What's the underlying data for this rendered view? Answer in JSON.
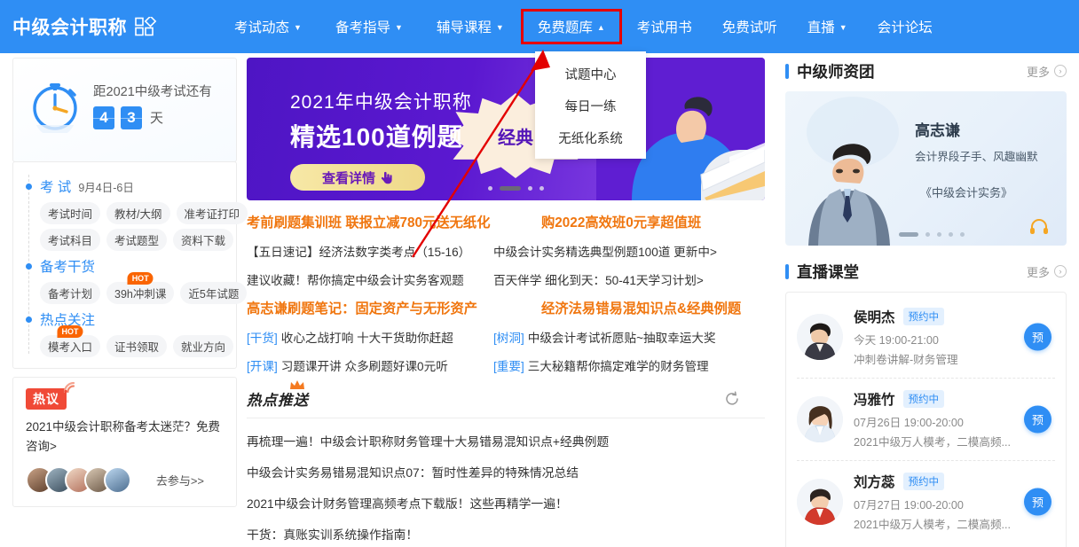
{
  "header": {
    "logo_text": "中级会计职称",
    "logo_icon": "grid-diamond-icon",
    "nav": [
      {
        "label": "考试动态",
        "caret": "▼"
      },
      {
        "label": "备考指导",
        "caret": "▼"
      },
      {
        "label": "辅导课程",
        "caret": "▼"
      },
      {
        "label": "免费题库",
        "caret": "▲",
        "active": true
      },
      {
        "label": "考试用书",
        "caret": ""
      },
      {
        "label": "免费试听",
        "caret": ""
      },
      {
        "label": "直播",
        "caret": "▼"
      },
      {
        "label": "会计论坛",
        "caret": ""
      }
    ],
    "highlight_color": "#e60000",
    "bar_color": "#2f8ef4"
  },
  "dropdown": {
    "items": [
      "试题中心",
      "每日一练",
      "无纸化系统"
    ]
  },
  "sidebar_left": {
    "countdown": {
      "label": "距2021中级考试还有",
      "digits": [
        "4",
        "3"
      ],
      "unit": "天",
      "icon": "stopwatch-icon"
    },
    "groups": [
      {
        "title": "考 试",
        "sub": "9月4日-6日",
        "rows": [
          [
            {
              "label": "考试时间"
            },
            {
              "label": "教材/大纲"
            },
            {
              "label": "准考证打印"
            }
          ],
          [
            {
              "label": "考试科目"
            },
            {
              "label": "考试题型"
            },
            {
              "label": "资料下载"
            }
          ]
        ]
      },
      {
        "title": "备考干货",
        "sub": "",
        "rows": [
          [
            {
              "label": "备考计划"
            },
            {
              "label": "39h冲刺课",
              "badge": "HOT"
            },
            {
              "label": "近5年试题"
            }
          ]
        ]
      },
      {
        "title": "热点关注",
        "sub": "",
        "rows": [
          [
            {
              "label": "模考入口",
              "badge": "HOT"
            },
            {
              "label": "证书领取"
            },
            {
              "label": "就业方向"
            }
          ]
        ]
      }
    ],
    "discussion": {
      "tag": "热议",
      "text": "2021中级会计职称备考太迷茫？免费咨询>",
      "go": "去参与>>",
      "avatar_count": 5
    }
  },
  "banner": {
    "line1": "2021年中级会计职称",
    "line2": "精选100道例题",
    "button": "查看详情",
    "button_icon": "hand-pointer-icon",
    "burst": "经典",
    "dot_count": 4,
    "active_dot": 1
  },
  "news": {
    "headline_row1": [
      "考前刷题集训班 联报立减780元送无纸化",
      "购2022高效班0元享超值班"
    ],
    "rows1": [
      [
        "【五日速记】经济法数字类考点（15-16）",
        "中级会计实务精选典型例题100道 更新中>"
      ],
      [
        "建议收藏！帮你搞定中级会计实务客观题",
        "百天伴学 细化到天：50-41天学习计划>"
      ]
    ],
    "headline_row2": [
      "高志谦刷题笔记：固定资产与无形资产",
      "经济法易错易混知识点&经典例题"
    ],
    "rows2": [
      [
        {
          "tag": "[干货]",
          "text": "收心之战打响 十大干货助你赶超"
        },
        {
          "tag": "[树洞]",
          "text": "中级会计考试祈愿贴~抽取幸运大奖"
        }
      ],
      [
        {
          "tag": "[开课]",
          "text": "习题课开讲 众多刷题好课0元听"
        },
        {
          "tag": "[重要]",
          "text": "三大秘籍帮你搞定难学的财务管理"
        }
      ]
    ]
  },
  "hot_push": {
    "title": "热点推送",
    "refresh_icon": "refresh-icon",
    "items": [
      "再梳理一遍！中级会计职称财务管理十大易错易混知识点+经典例题",
      "中级会计实务易错易混知识点07：暂时性差异的特殊情况总结",
      "2021中级会计财务管理高频考点下载版！这些再精学一遍！",
      "干货：真账实训系统操作指南！"
    ]
  },
  "sidebar_right": {
    "teachers_section": {
      "title": "中级师资团",
      "more": "更多",
      "teacher": {
        "name": "高志谦",
        "desc": "会计界段子手、风趣幽默",
        "book": "《中级会计实务》",
        "headset_icon": "headset-icon"
      },
      "dot_count": 5,
      "active_dot": 0
    },
    "live_section": {
      "title": "直播课堂",
      "more": "更多",
      "rows": [
        {
          "name": "侯明杰",
          "badge": "预约中",
          "time": "今天 19:00-21:00",
          "sub": "冲刺卷讲解-财务管理",
          "btn": "预"
        },
        {
          "name": "冯雅竹",
          "badge": "预约中",
          "time": "07月26日 19:00-20:00",
          "sub": "2021中级万人模考，二模高频...",
          "btn": "预"
        },
        {
          "name": "刘方蕊",
          "badge": "预约中",
          "time": "07月27日 19:00-20:00",
          "sub": "2021中级万人模考，二模高频...",
          "btn": "预"
        }
      ]
    }
  },
  "annotation": {
    "arrow": "red-arrow-pointer",
    "arrow_color": "#e30000"
  }
}
